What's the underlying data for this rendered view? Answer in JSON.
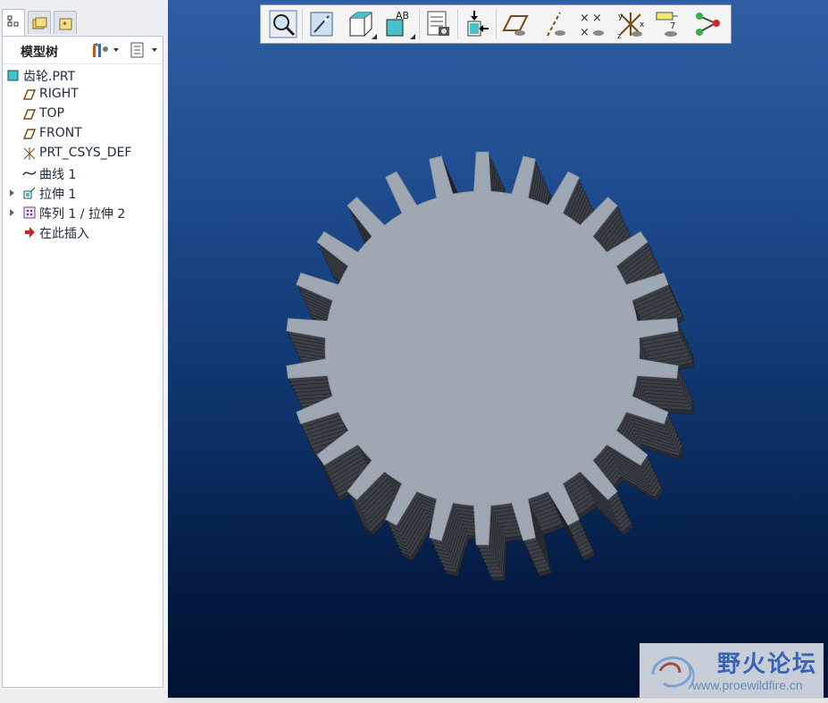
{
  "model_tree": {
    "title": "模型树",
    "items": [
      {
        "label": "齿轮.PRT",
        "icon": "part-icon",
        "expandable": false
      },
      {
        "label": "RIGHT",
        "icon": "datum-plane-icon",
        "expandable": false
      },
      {
        "label": "TOP",
        "icon": "datum-plane-icon",
        "expandable": false
      },
      {
        "label": "FRONT",
        "icon": "datum-plane-icon",
        "expandable": false
      },
      {
        "label": "PRT_CSYS_DEF",
        "icon": "coordinate-system-icon",
        "expandable": false
      },
      {
        "label": "曲线 1",
        "icon": "curve-icon",
        "expandable": false
      },
      {
        "label": "拉伸 1",
        "icon": "extrude-icon",
        "expandable": true
      },
      {
        "label": "阵列 1 / 拉伸 2",
        "icon": "pattern-icon",
        "expandable": true
      },
      {
        "label": "在此插入",
        "icon": "insert-here-arrow-icon",
        "expandable": false
      }
    ]
  },
  "panel_tabs": [
    "model-tree-tab-icon",
    "folder-browser-tab-icon",
    "favorites-tab-icon"
  ],
  "toolbar": {
    "buttons": [
      "zoom-icon",
      "repaint-icon",
      "view-orientation-icon",
      "named-view-icon",
      "layer-icon",
      "spin-center-icon",
      "datum-plane-display-icon",
      "datum-axis-display-icon",
      "datum-point-display-icon",
      "coordinate-system-display-icon",
      "annotation-display-icon",
      "model-display-icon"
    ]
  },
  "watermark": {
    "title": "野火论坛",
    "url": "www.proewildfire.cn"
  },
  "colors": {
    "viewport_top": "#2f5ea2",
    "viewport_bottom": "#011233",
    "gear_face": "#9ea7b2",
    "gear_side": "#3b3f45"
  }
}
